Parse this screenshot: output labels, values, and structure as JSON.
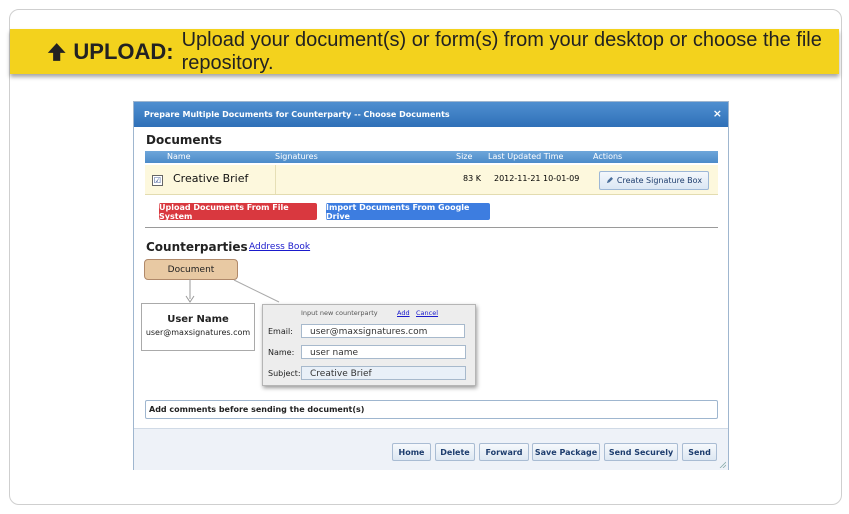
{
  "banner": {
    "icon": "upload-arrow-icon",
    "strong": "UPLOAD:",
    "text": "Upload your document(s) or form(s) from your desktop or choose the file repository."
  },
  "dialog": {
    "title": "Prepare Multiple Documents for Counterparty -- Choose Documents",
    "close": "×",
    "documents_heading": "Documents",
    "columns": [
      "Name",
      "Signatures",
      "Size",
      "Last Updated Time",
      "Actions"
    ],
    "rows": [
      {
        "checked": true,
        "check_mark": "☑",
        "name": "Creative Brief",
        "signatures": "",
        "size": "83 K",
        "updated": "2012-11-21 10-01-09",
        "action": "Create Signature Box"
      }
    ],
    "upload_button": "Upload Documents From File System",
    "import_button": "Import Documents From Google Drive",
    "counterparties_heading": "Counterparties",
    "address_book": "Address Book",
    "document_node": "Document",
    "user_box": {
      "name": "User Name",
      "email": "user@maxsignatures.com"
    },
    "popup": {
      "header": "Input new counterparty",
      "add": "Add",
      "cancel": "Cancel",
      "email_label": "Email:",
      "email_value": "user@maxsignatures.com",
      "name_label": "Name:",
      "name_value": "user name",
      "subject_label": "Subject:",
      "subject_value": "Creative Brief"
    },
    "comments_placeholder": "Add comments before sending the document(s)",
    "footer_buttons": [
      "Home",
      "Delete",
      "Forward",
      "Save Package",
      "Send Securely",
      "Send"
    ]
  },
  "colors": {
    "banner": "#f3d21d",
    "title_bar": "#3a7cc2",
    "upload_button": "#d9383f",
    "import_button": "#3d7de0",
    "document_node": "#e8c9a3",
    "row_highlight": "#fdf8dd"
  }
}
